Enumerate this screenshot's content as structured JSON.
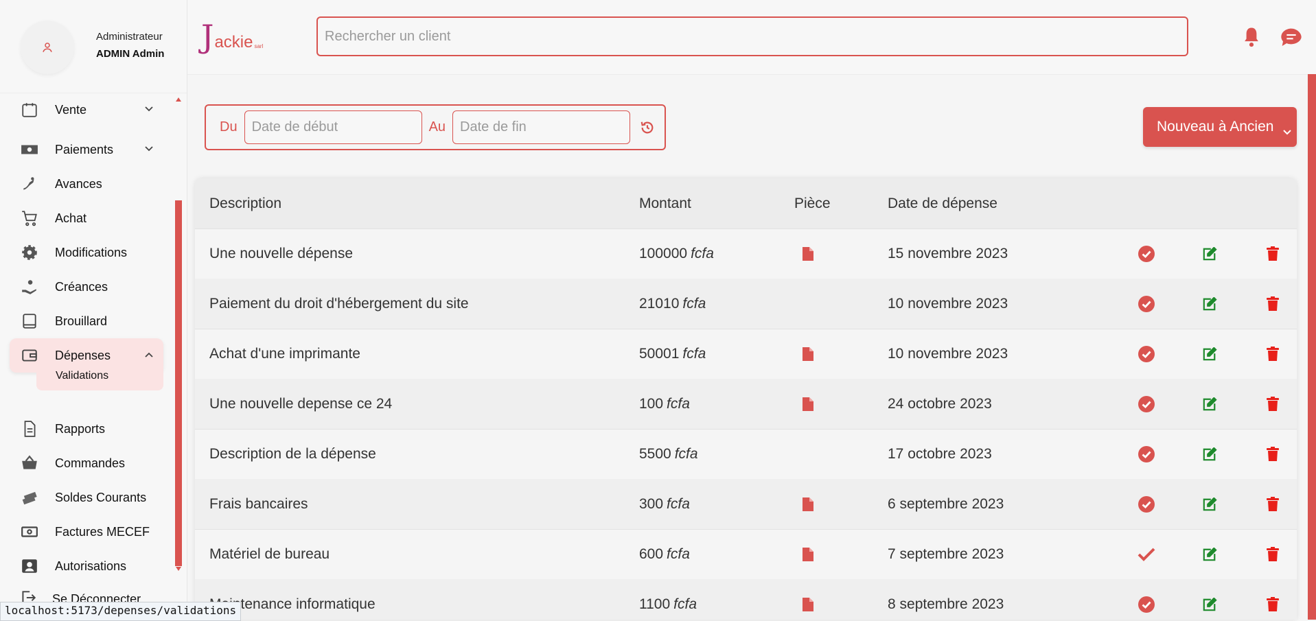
{
  "colors": {
    "accent": "#d9534f",
    "brand_j": "#b0307a",
    "edit_green": "#1e8a2c",
    "delete_red": "#e8201a",
    "active_bg": "#fbe3e3"
  },
  "profile": {
    "role": "Administrateur",
    "name": "ADMIN Admin",
    "icon": "user-icon"
  },
  "brand": {
    "j": "J",
    "rest": "ackie",
    "sarl": "sarl"
  },
  "search": {
    "placeholder": "Rechercher un client"
  },
  "header_icons": [
    "bell-icon",
    "chat-icon"
  ],
  "nav": {
    "items": [
      {
        "label": "Vente",
        "icon": "calendar-icon",
        "expandable": true
      },
      {
        "label": "Paiements",
        "icon": "money-icon",
        "expandable": true
      },
      {
        "label": "Avances",
        "icon": "hand-coin-icon"
      },
      {
        "label": "Achat",
        "icon": "cart-icon"
      },
      {
        "label": "Modifications",
        "icon": "gear-icon"
      },
      {
        "label": "Créances",
        "icon": "hand-holding-icon"
      },
      {
        "label": "Brouillard",
        "icon": "book-icon"
      },
      {
        "label": "Dépenses",
        "icon": "wallet-icon",
        "expanded": true,
        "active": true
      },
      {
        "label": "Rapports",
        "icon": "file-icon"
      },
      {
        "label": "Commandes",
        "icon": "basket-icon"
      },
      {
        "label": "Soldes Courants",
        "icon": "money-stack-icon"
      },
      {
        "label": "Factures MECEF",
        "icon": "money-icon"
      },
      {
        "label": "Autorisations",
        "icon": "user-badge-icon"
      }
    ],
    "sub_item": "Validations",
    "logout": "Se Déconnecter"
  },
  "status_url": "localhost:5173/depenses/validations",
  "filters": {
    "du": "Du",
    "au": "Au",
    "start_placeholder": "Date de début",
    "end_placeholder": "Date de fin",
    "reset_icon": "history-icon"
  },
  "sort": {
    "label": "Nouveau à Ancien"
  },
  "table": {
    "headers": [
      "Description",
      "Montant",
      "Pièce",
      "Date de dépense"
    ],
    "currency": "fcfa",
    "rows": [
      {
        "description": "Une nouvelle dépense",
        "amount": "100000",
        "piece": true,
        "date": "15 novembre 2023",
        "validated": true
      },
      {
        "description": "Paiement du droit d'hébergement du site",
        "amount": "21010",
        "piece": false,
        "date": "10 novembre 2023",
        "validated": true
      },
      {
        "description": "Achat d'une imprimante",
        "amount": "50001",
        "piece": true,
        "date": "10 novembre 2023",
        "validated": true
      },
      {
        "description": "Une nouvelle depense ce 24",
        "amount": "100",
        "piece": true,
        "date": "24 octobre 2023",
        "validated": true
      },
      {
        "description": "Description de la dépense",
        "amount": "5500",
        "piece": false,
        "date": "17 octobre 2023",
        "validated": true
      },
      {
        "description": "Frais bancaires",
        "amount": "300",
        "piece": true,
        "date": "6 septembre 2023",
        "validated": true
      },
      {
        "description": "Matériel de bureau",
        "amount": "600",
        "piece": true,
        "date": "7 septembre 2023",
        "validated": false
      },
      {
        "description": "Maintenance informatique",
        "amount": "1100",
        "piece": true,
        "date": "8 septembre 2023",
        "validated": true
      }
    ]
  }
}
